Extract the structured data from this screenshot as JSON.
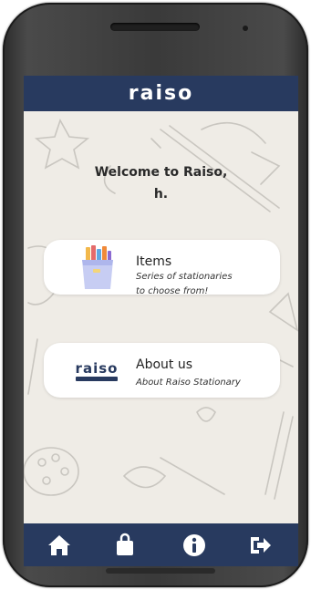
{
  "app": {
    "title": "raiso"
  },
  "welcome": {
    "line1": "Welcome to Raiso,",
    "line2": "h."
  },
  "cards": {
    "items": {
      "icon": "stationery-bag-icon",
      "title": "Items",
      "subtitle_line1": "Series of stationaries",
      "subtitle_line2": "to choose from!"
    },
    "about": {
      "icon": "raiso-logo",
      "logo_text": "raiso",
      "title": "About us",
      "subtitle": "About Raiso Stationary"
    }
  },
  "bottom_nav": {
    "items": [
      "home-icon",
      "shopping-bag-icon",
      "info-icon",
      "logout-icon"
    ]
  },
  "colors": {
    "header": "#283a5f",
    "background": "#efece6",
    "card": "#ffffff"
  }
}
